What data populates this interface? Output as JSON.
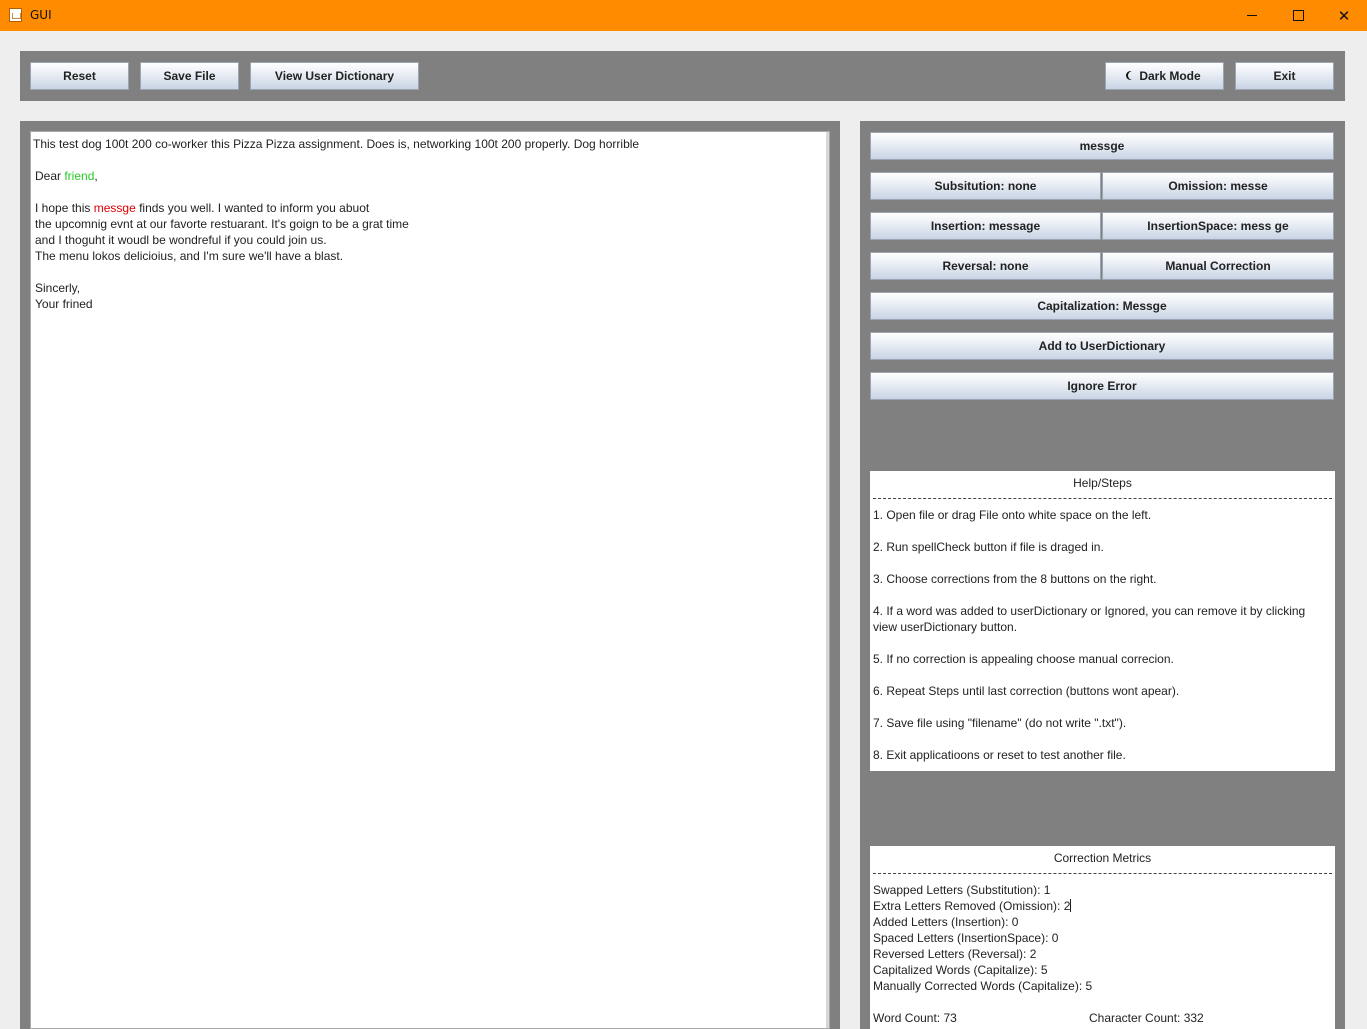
{
  "window": {
    "title": "GUI",
    "controls": {
      "minimize": "minimize-icon",
      "maximize": "maximize-icon",
      "close": "close-icon"
    }
  },
  "toolbar": {
    "reset": "Reset",
    "save_file": "Save File",
    "view_user_dictionary": "View User Dictionary",
    "dark_mode": "Dark Mode",
    "dark_mode_icon": "moon-icon",
    "exit": "Exit"
  },
  "editor": {
    "line1": "This test dog 100t 200 co-worker this Pizza Pizza assignment. Does is, networking 100t 200 properly. Dog horrible",
    "greeting_prefix": "Dear ",
    "greeting_word": "friend",
    "greeting_suffix": ",",
    "para1_prefix": "I hope this ",
    "para1_error_word": "messge",
    "para1_suffix": " finds you well. I wanted to inform you abuot",
    "para2": "the upcomnig evnt at our favorte restuarant. It's goign to be a grat time",
    "para3": "and I thoguht it woudl be wondreful if you could join us.",
    "para4": "The menu lokos delicioius, and I'm sure we'll have a blast.",
    "closing": "Sincerly,",
    "signature": "Your frined"
  },
  "corrections": {
    "current_word": "messge",
    "substitution": "Subsitution: none",
    "omission": "Omission: messe",
    "insertion": "Insertion: message",
    "insertion_space": "InsertionSpace: mess ge",
    "reversal": "Reversal: none",
    "manual": "Manual Correction",
    "capitalization": "Capitalization: Messge",
    "add_to_dictionary": "Add to UserDictionary",
    "ignore": "Ignore Error"
  },
  "help": {
    "title": "Help/Steps",
    "step1": "1. Open file or drag File onto white space on the left.",
    "step2": "2. Run spellCheck button if file is draged in.",
    "step3": "3. Choose corrections from the 8 buttons on the right.",
    "step4a": "4. If a word was added to userDictionary or Ignored, you can remove it by clicking",
    "step4b": "view userDictionary button.",
    "step5": "5. If no correction is appealing choose manual correcion.",
    "step6": "6. Repeat Steps until last correction (buttons wont apear).",
    "step7": "7. Save file using \"filename\" (do not write \".txt\").",
    "step8": "8. Exit applicatioons or reset to test another file."
  },
  "metrics": {
    "title": "Correction Metrics",
    "swapped": "Swapped Letters (Substitution): 1",
    "extra": "Extra Letters Removed (Omission): 2",
    "added": "Added Letters (Insertion): 0",
    "spaced": "Spaced Letters (InsertionSpace): 0",
    "reversed": "Reversed Letters (Reversal): 2",
    "capitalized": "Capitalized Words (Capitalize): 5",
    "manual": "Manually Corrected Words (Capitalize): 5",
    "word_count": "Word Count: 73",
    "char_count": "Character Count: 332"
  },
  "colors": {
    "title_bar": "#ff8c00",
    "panel": "#808080",
    "error_word": "#e00000",
    "accepted_word": "#22cc22"
  }
}
